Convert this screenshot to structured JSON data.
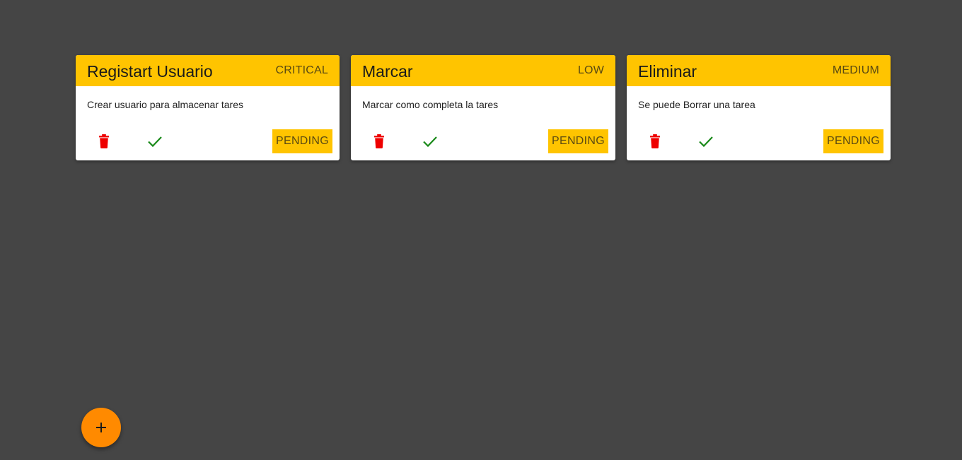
{
  "colors": {
    "background": "#454545",
    "card_header": "#ffc400",
    "delete_icon": "#ee0000",
    "check_icon": "#1a8a1a",
    "fab": "#ff8a00"
  },
  "tasks": [
    {
      "title": "Registart Usuario",
      "priority": "CRITICAL",
      "description": "Crear usuario para almacenar tares",
      "status": "PENDING",
      "delete_icon": "trash-icon",
      "complete_icon": "check-icon"
    },
    {
      "title": "Marcar",
      "priority": "LOW",
      "description": "Marcar como completa la tares",
      "status": "PENDING",
      "delete_icon": "trash-icon",
      "complete_icon": "check-icon"
    },
    {
      "title": "Eliminar",
      "priority": "MEDIUM",
      "description": "Se puede Borrar una tarea",
      "status": "PENDING",
      "delete_icon": "trash-icon",
      "complete_icon": "check-icon"
    }
  ],
  "fab": {
    "icon": "plus-icon"
  }
}
